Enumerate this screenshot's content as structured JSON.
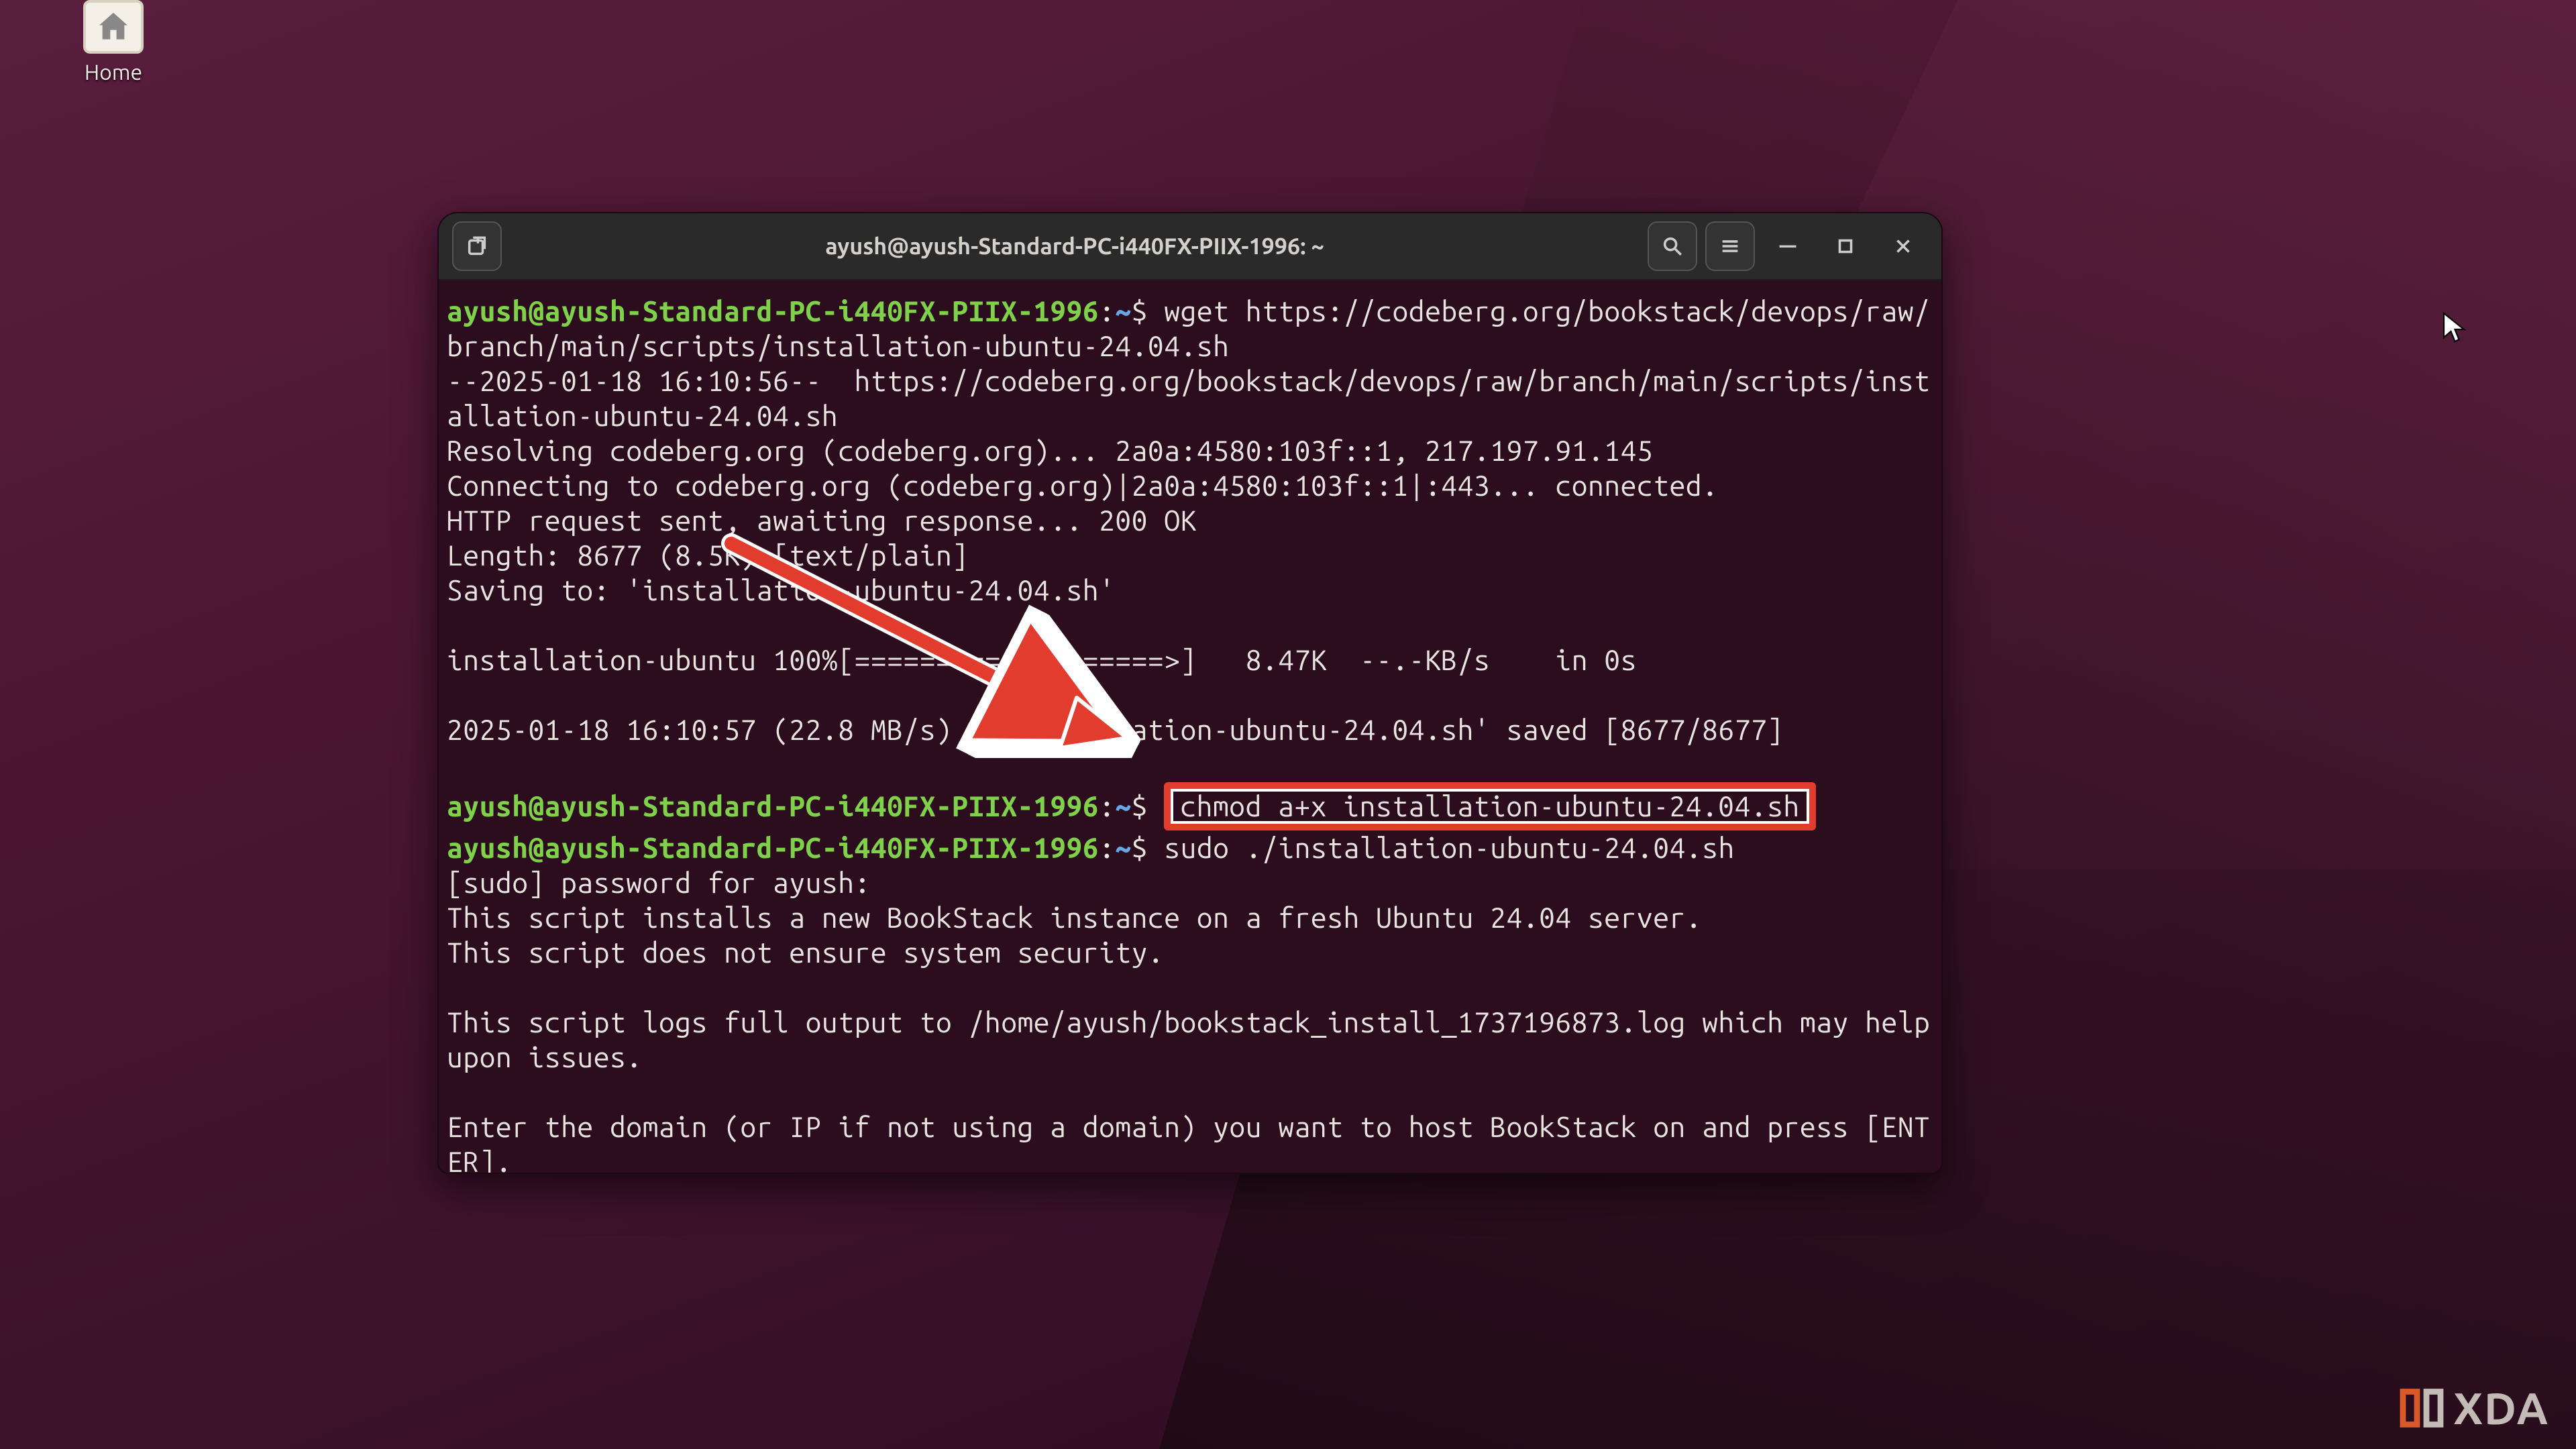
{
  "desktop": {
    "home_label": "Home"
  },
  "window": {
    "title": "ayush@ayush-Standard-PC-i440FX-PIIX-1996: ~",
    "titlebar": {
      "new_tab": "New Tab",
      "search": "Search",
      "menu": "Menu",
      "minimize": "Minimize",
      "maximize": "Maximize",
      "close": "Close"
    }
  },
  "prompt": {
    "user": "ayush@ayush-Standard-PC-i440FX-PIIX-1996",
    "path": "~",
    "sep": ":",
    "dollar": "$"
  },
  "terminal": {
    "cmd1": "wget https://codeberg.org/bookstack/devops/raw/branch/main/scripts/installation-ubuntu-24.04.sh",
    "wget_ts": "--2025-01-18 16:10:56--  https://codeberg.org/bookstack/devops/raw/branch/main/scripts/installation-ubuntu-24.04.sh",
    "resolve": "Resolving codeberg.org (codeberg.org)... 2a0a:4580:103f::1, 217.197.91.145",
    "connect": "Connecting to codeberg.org (codeberg.org)|2a0a:4580:103f::1|:443... connected.",
    "http": "HTTP request sent, awaiting response... 200 OK",
    "length": "Length: 8677 (8.5K) [text/plain]",
    "saving": "Saving to: 'installation-ubuntu-24.04.sh'",
    "blank1": " ",
    "progress": "installation-ubuntu 100%[===================>]   8.47K  --.-KB/s    in 0s",
    "blank2": " ",
    "done": "2025-01-18 16:10:57 (22.8 MB/s) - 'installation-ubuntu-24.04.sh' saved [8677/8677]",
    "blank3": " ",
    "cmd2_boxed": "chmod a+x installation-ubuntu-24.04.sh",
    "cmd3": "sudo ./installation-ubuntu-24.04.sh",
    "sudo": "[sudo] password for ayush:",
    "inst1": "This script installs a new BookStack instance on a fresh Ubuntu 24.04 server.",
    "inst2": "This script does not ensure system security.",
    "blank4": " ",
    "log": "This script logs full output to /home/ayush/bookstack_install_1737196873.log which may help upon issues.",
    "blank5": " ",
    "enter": "Enter the domain (or IP if not using a domain) you want to host BookStack on and press [ENTER].",
    "cursor": ""
  },
  "annotation": {
    "name": "arrow-to-chmod-command"
  },
  "watermark": {
    "text": "XDA"
  },
  "colors": {
    "prompt_user": "#7fd14a",
    "prompt_path": "#6aa7e8",
    "text": "#e8e4e0",
    "window_bg": "#2b0d1e",
    "titlebar_bg": "#2a2a2a",
    "highlight_border": "#e23c2e"
  }
}
